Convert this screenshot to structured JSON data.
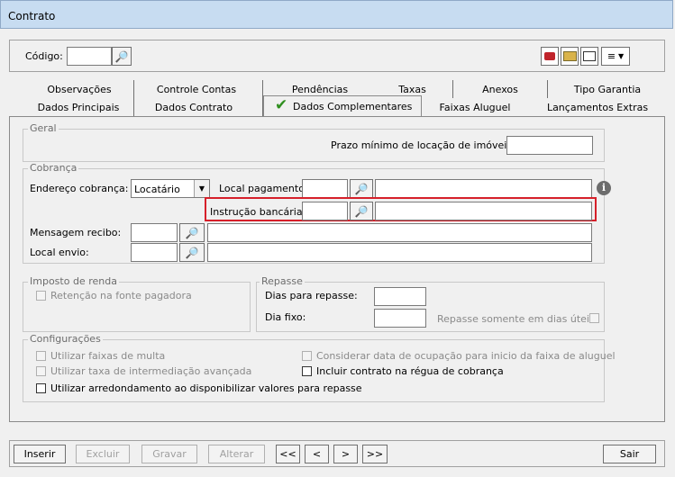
{
  "window": {
    "title": "Contrato"
  },
  "header": {
    "codigo_label": "Código:",
    "codigo_value": ""
  },
  "tabs": {
    "row1": [
      "Observações",
      "Controle Contas",
      "Pendências",
      "Taxas",
      "Anexos",
      "Tipo Garantia"
    ],
    "row2": [
      "Dados Principais",
      "Dados Contrato",
      "Dados Complementares",
      "Faixas Aluguel",
      "Lançamentos Extras"
    ],
    "active": "Dados Complementares"
  },
  "geral": {
    "title": "Geral",
    "prazo_label": "Prazo mínimo de locação de imóveis:",
    "prazo_value": ""
  },
  "cobranca": {
    "title": "Cobrança",
    "endereco_label": "Endereço cobrança:",
    "endereco_value": "Locatário",
    "local_pagamento_label": "Local pagamento:",
    "instrucao_label": "Instrução bancária:",
    "mensagem_label": "Mensagem recibo:",
    "local_envio_label": "Local envio:"
  },
  "imposto": {
    "title": "Imposto de renda",
    "retencao_label": "Retenção na fonte pagadora"
  },
  "repasse": {
    "title": "Repasse",
    "dias_label": "Dias para repasse:",
    "dia_fixo_label": "Dia fixo:",
    "dias_uteis_label": "Repasse somente em dias úteis"
  },
  "configuracoes": {
    "title": "Configurações",
    "faixas_multa": "Utilizar faixas de multa",
    "taxa_intermediacao": "Utilizar taxa de intermediação avançada",
    "arredondamento": "Utilizar arredondamento ao disponibilizar valores para repasse",
    "considerar_data": "Considerar data de ocupação para inicio da faixa de aluguel",
    "incluir_regua": "Incluir contrato na régua de cobrança"
  },
  "footer": {
    "inserir": "Inserir",
    "excluir": "Excluir",
    "gravar": "Gravar",
    "alterar": "Alterar",
    "first": "<<",
    "prev": "<",
    "next": ">",
    "last": ">>",
    "sair": "Sair"
  },
  "colors": {
    "highlight": "#d6202a",
    "check": "#2f8f1f",
    "title_bar": "#c7dcf1"
  }
}
